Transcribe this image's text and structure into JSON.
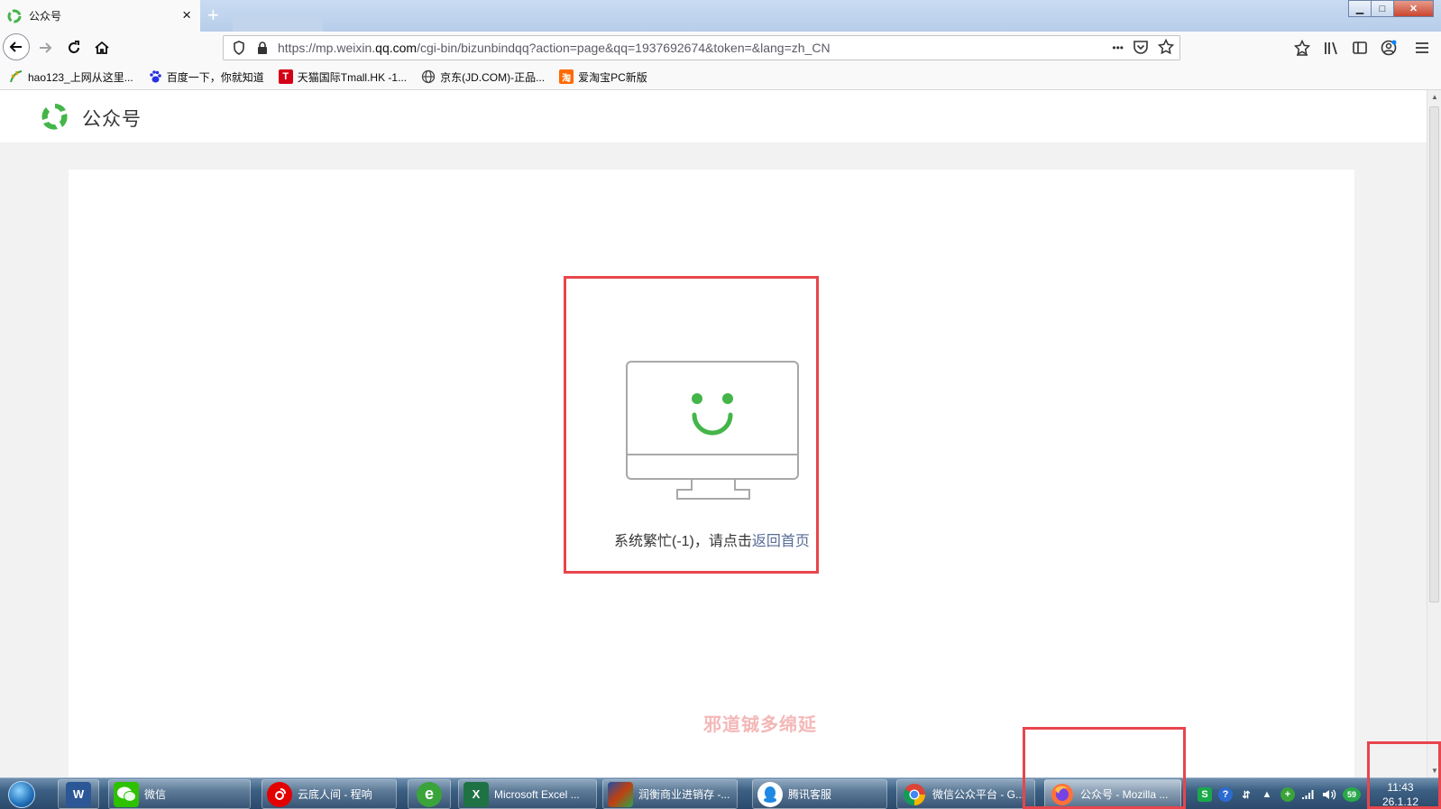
{
  "browser": {
    "tab": {
      "title": "公众号",
      "close_icon": "×"
    },
    "newtab_icon": "+",
    "window_controls": {
      "minimize": "▁",
      "maximize": "□",
      "close": "✕"
    },
    "url": {
      "prefix": "https://mp.weixin.",
      "domain": "qq.com",
      "path": "/cgi-bin/bizunbindqq?action=page&qq=1937692674&token=&lang=zh_CN"
    },
    "url_actions": {
      "more": "•••"
    }
  },
  "bookmarks": [
    {
      "label": "hao123_上网从这里...",
      "icon": "hao123-icon",
      "glyph": "",
      "color": "#3aa33a"
    },
    {
      "label": "百度一下，你就知道",
      "icon": "baidu-paw-icon",
      "glyph": "",
      "color": "#2932e1"
    },
    {
      "label": "天猫国际Tmall.HK -1...",
      "icon": "tmall-icon",
      "glyph": "T",
      "color": "#d40016"
    },
    {
      "label": "京东(JD.COM)-正品...",
      "icon": "globe-icon",
      "glyph": "",
      "color": "#555555"
    },
    {
      "label": "爱淘宝PC新版",
      "icon": "aitaobao-icon",
      "glyph": "淘",
      "color": "#ff6a00"
    }
  ],
  "site": {
    "brand": "公众号",
    "error": {
      "message": "系统繁忙(-1)，请点击",
      "link": "返回首页"
    },
    "watermark": "邪道铖多绵延"
  },
  "taskbar": {
    "apps": [
      {
        "label": "",
        "icon": "word-icon",
        "glyph": "W",
        "bg": "#2b5797",
        "pinned": true
      },
      {
        "label": "微信",
        "icon": "wechat-icon",
        "glyph": "",
        "bg": "#2dc100",
        "pinned": false
      },
      {
        "label": "云底人间 - 程响",
        "icon": "netease-music-icon",
        "glyph": "",
        "bg": "#e20000",
        "pinned": false
      },
      {
        "label": "",
        "icon": "ie-ai-icon",
        "glyph": "e",
        "bg": "#3aa33a",
        "pinned": true
      },
      {
        "label": "Microsoft Excel ...",
        "icon": "excel-icon",
        "glyph": "X",
        "bg": "#1f7244",
        "pinned": false
      },
      {
        "label": "润衡商业进销存 -...",
        "icon": "erp-icon",
        "glyph": "",
        "bg": "#c04010",
        "pinned": false
      },
      {
        "label": "腾讯客服",
        "icon": "tencent-service-icon",
        "glyph": "",
        "bg": "#1e88e5",
        "pinned": false
      },
      {
        "label": "微信公众平台 - G...",
        "icon": "chrome-icon",
        "glyph": "",
        "bg": "#ffffff",
        "pinned": false
      },
      {
        "label": "公众号 - Mozilla ...",
        "icon": "firefox-icon",
        "glyph": "",
        "bg": "#ff7139",
        "pinned": false,
        "active": true
      }
    ],
    "tray": {
      "badge": "59",
      "clock_time": "11:43",
      "clock_date": "26.1.12"
    }
  },
  "colors": {
    "accent_green": "#44b549",
    "link": "#576b95",
    "highlight": "#e8454c"
  }
}
